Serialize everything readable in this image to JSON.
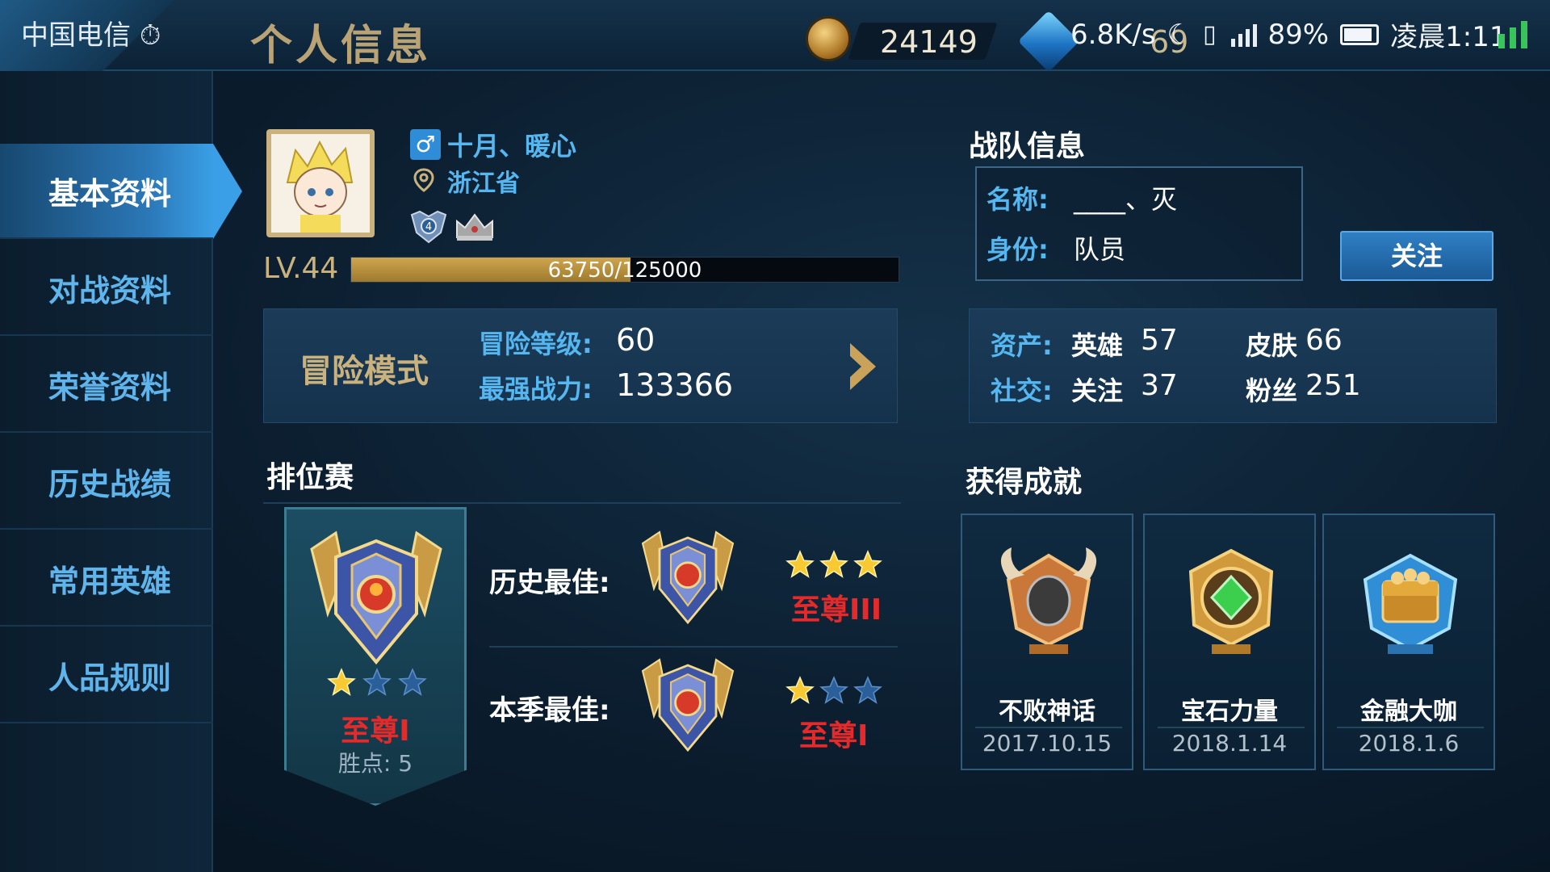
{
  "status_bar": {
    "carrier": "中国电信",
    "net_speed": "6.8K/s",
    "battery": "89%",
    "time": "凌晨1:11"
  },
  "header": {
    "title": "个人信息",
    "coins": "24149",
    "gems": "69"
  },
  "sidebar": {
    "items": [
      {
        "label": "基本资料",
        "active": true
      },
      {
        "label": "对战资料"
      },
      {
        "label": "荣誉资料"
      },
      {
        "label": "历史战绩"
      },
      {
        "label": "常用英雄"
      },
      {
        "label": "人品规则"
      }
    ]
  },
  "profile": {
    "name": "十月、暖心",
    "location": "浙江省",
    "level": "LV.44",
    "xp_text": "63750/125000",
    "xp_progress": 0.51,
    "badge_level": "4"
  },
  "adventure": {
    "title": "冒险模式",
    "level_label": "冒险等级:",
    "level_value": "60",
    "power_label": "最强战力:",
    "power_value": "133366"
  },
  "team": {
    "title": "战队信息",
    "name_label": "名称:",
    "name_value": "____、灭",
    "role_label": "身份:",
    "role_value": "队员",
    "follow_label": "关注"
  },
  "assets": {
    "assets_label": "资产:",
    "heroes_label": "英雄",
    "heroes_value": "57",
    "skins_label": "皮肤",
    "skins_value": "66",
    "social_label": "社交:",
    "following_label": "关注",
    "following_value": "37",
    "fans_label": "粉丝",
    "fans_value": "251"
  },
  "rank": {
    "title": "排位赛",
    "current": {
      "name": "至尊I",
      "points_label": "胜点:",
      "points_value": "5",
      "stars": 1,
      "max_stars": 3
    },
    "history_best": {
      "label": "历史最佳:",
      "name": "至尊III",
      "stars": 3,
      "max_stars": 3
    },
    "season_best": {
      "label": "本季最佳:",
      "name": "至尊I",
      "stars": 1,
      "max_stars": 3
    }
  },
  "achievements": {
    "title": "获得成就",
    "items": [
      {
        "name": "不败神话",
        "date": "2017.10.15",
        "icon": "horned-helmet-icon",
        "color": "#c9783a"
      },
      {
        "name": "宝石力量",
        "date": "2018.1.14",
        "icon": "green-gem-icon",
        "color": "#d09a3c"
      },
      {
        "name": "金融大咖",
        "date": "2018.1.6",
        "icon": "treasure-chest-icon",
        "color": "#3aa6e8"
      }
    ]
  },
  "colors": {
    "accent_blue": "#55b6f0",
    "gold": "#c9b27e",
    "rank_red": "#e42a2a"
  }
}
